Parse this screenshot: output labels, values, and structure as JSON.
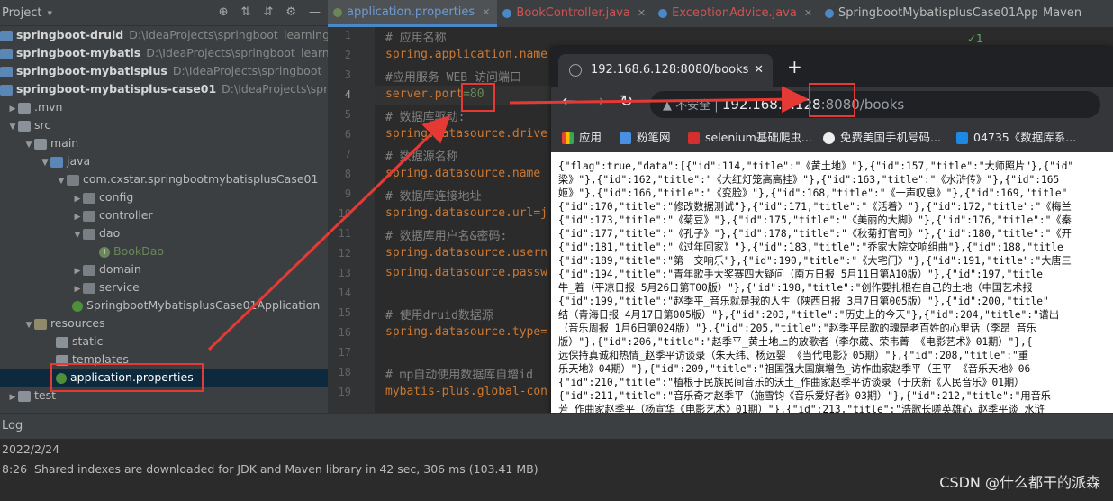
{
  "project": {
    "title": "Project",
    "rows": [
      {
        "name": "springboot-druid",
        "path": "D:\\IdeaProjects\\springboot_learning\\spri"
      },
      {
        "name": "springboot-mybatis",
        "path": "D:\\IdeaProjects\\springboot_learning\\sp"
      },
      {
        "name": "springboot-mybatisplus",
        "path": "D:\\IdeaProjects\\springboot_learni"
      },
      {
        "name": "springboot-mybatisplus-case01",
        "path": "D:\\IdeaProjects\\springboo"
      }
    ],
    "tree": {
      "mvn": ".mvn",
      "src": "src",
      "main": "main",
      "java": "java",
      "package": "com.cxstar.springbootmybatisplusCase01",
      "config": "config",
      "controller": "controller",
      "dao": "dao",
      "bookdao": "BookDao",
      "domain": "domain",
      "service": "service",
      "app": "SpringbootMybatisplusCase01Application",
      "resources": "resources",
      "static": "static",
      "templates": "templates",
      "appprops": "application.properties",
      "test": "test"
    }
  },
  "tabs": [
    {
      "label": "application.properties",
      "color": "#6a8759"
    },
    {
      "label": "BookController.java",
      "color": "#c75450"
    },
    {
      "label": "ExceptionAdvice.java",
      "color": "#c75450"
    },
    {
      "label": "SpringbootMybatisplusCase01Applic",
      "color": "#4a88c7"
    }
  ],
  "maven_label": "Maven",
  "editor": {
    "line_numbers": [
      "1",
      "2",
      "3",
      "4",
      "5",
      "6",
      "7",
      "8",
      "9",
      "10",
      "11",
      "12",
      "13",
      "14",
      "15",
      "16",
      "17",
      "18",
      "19",
      "20"
    ],
    "lines": [
      {
        "c": "# 应用名称"
      },
      {
        "k": "spring.application.name"
      },
      {
        "c": "#应用服务 WEB 访问端口"
      },
      {
        "k": "server.port",
        "v": "=80"
      },
      {
        "c": "# 数据库驱动:"
      },
      {
        "k": "spring.datasource.drive"
      },
      {
        "c": "# 数据源名称"
      },
      {
        "k": "spring.datasource.name"
      },
      {
        "c": "# 数据库连接地址"
      },
      {
        "k": "spring.datasource.url=j"
      },
      {
        "c": "# 数据库用户名&密码:"
      },
      {
        "k": "spring.datasource.usern"
      },
      {
        "k": "spring.datasource.passw"
      },
      {
        "c": ""
      },
      {
        "c": "# 使用druid数据源"
      },
      {
        "k": "spring.datasource.type="
      },
      {
        "c": ""
      },
      {
        "c": "# mp自动使用数据库自增id"
      },
      {
        "k": "mybatis-plus.global-con"
      }
    ]
  },
  "browser": {
    "tab_title": "192.168.6.128:8080/books",
    "url_warning": "不安全",
    "url_host": "192.168.6.128",
    "url_rest": ":8080/books",
    "bookmarks": [
      "应用",
      "粉笔网",
      "selenium基础爬虫...",
      "免费美国手机号码...",
      "04735《数据库系..."
    ],
    "json_lines": [
      "{\"flag\":true,\"data\":[{\"id\":114,\"title\":\"《黄土地》\"},{\"id\":157,\"title\":\"大师照片\"},{\"id\"",
      "梁》\"},{\"id\":162,\"title\":\"《大红灯笼高高挂》\"},{\"id\":163,\"title\":\"《水浒传》\"},{\"id\":165",
      "姬》\"},{\"id\":166,\"title\":\"《变脸》\"},{\"id\":168,\"title\":\"《一声叹息》\"},{\"id\":169,\"title\"",
      "{\"id\":170,\"title\":\"修改数据测试\"},{\"id\":171,\"title\":\"《活着》\"},{\"id\":172,\"title\":\"《梅兰",
      "{\"id\":173,\"title\":\"《菊豆》\"},{\"id\":175,\"title\":\"《美丽的大脚》\"},{\"id\":176,\"title\":\"《秦",
      "{\"id\":177,\"title\":\"《孔子》\"},{\"id\":178,\"title\":\"《秋菊打官司》\"},{\"id\":180,\"title\":\"《开",
      "{\"id\":181,\"title\":\"《过年回家》\"},{\"id\":183,\"title\":\"乔家大院交响组曲\"},{\"id\":188,\"title",
      "{\"id\":189,\"title\":\"第一交响乐\"},{\"id\":190,\"title\":\"《大宅门》\"},{\"id\":191,\"title\":\"大唐三",
      "{\"id\":194,\"title\":\"青年歌手大奖赛四大疑问（南方日报 5月11日第A10版）\"},{\"id\":197,\"title",
      "牛_着（平凉日报 5月26日第T00版）\"},{\"id\":198,\"title\":\"创作要扎根在自己的土地（中国艺术报",
      "{\"id\":199,\"title\":\"赵季平_音乐就是我的人生（陕西日报 3月7日第005版）\"},{\"id\":200,\"title\"",
      "结（青海日报 4月17日第005版）\"},{\"id\":203,\"title\":\"历史上的今天\"},{\"id\":204,\"title\":\"谱出",
      "（音乐周报 1月6日第024版）\"},{\"id\":205,\"title\":\"赵季平民歌的魂是老百姓的心里话（李昂 音乐",
      "版）\"},{\"id\":206,\"title\":\"赵季平_黄土地上的放歌者（李尔葳、荣韦菁 《电影艺术》01期）\"},{",
      "远保持真诚和热情_赵季平访谈录（朱天纬、杨远婴 《当代电影》05期）\"},{\"id\":208,\"title\":\"重",
      "乐天地》04期）\"},{\"id\":209,\"title\":\"祖国强大国旗增色_访作曲家赵季平（王平 《音乐天地》06",
      "{\"id\":210,\"title\":\"植根于民族民间音乐的沃土_作曲家赵季平访谈录（于庆新《人民音乐》01期）",
      "{\"id\":211,\"title\":\"音乐奇才赵季平（施雪钧《音乐爱好者》03期）\"},{\"id\":212,\"title\":\"用音乐",
      "芳_作曲家赵季平（杨宣华《电影艺术》01期）\"},{\"id\":213,\"title\":\"浩歌长嗟英雄心_赵季平谈_水浒",
      "岭歌声》02期）\"},{\"id\":217,\"title\":\"感受和谐（人民音乐海外版 7月10日第3版）\"},{\"id\":218,"
    ]
  },
  "log": {
    "title": "Log",
    "date": "2022/2/24",
    "time": "8:26",
    "message": "Shared indexes are downloaded for JDK and Maven library in 42 sec, 306 ms (103.41 MB)"
  },
  "watermark": "CSDN @什么都干的派森"
}
